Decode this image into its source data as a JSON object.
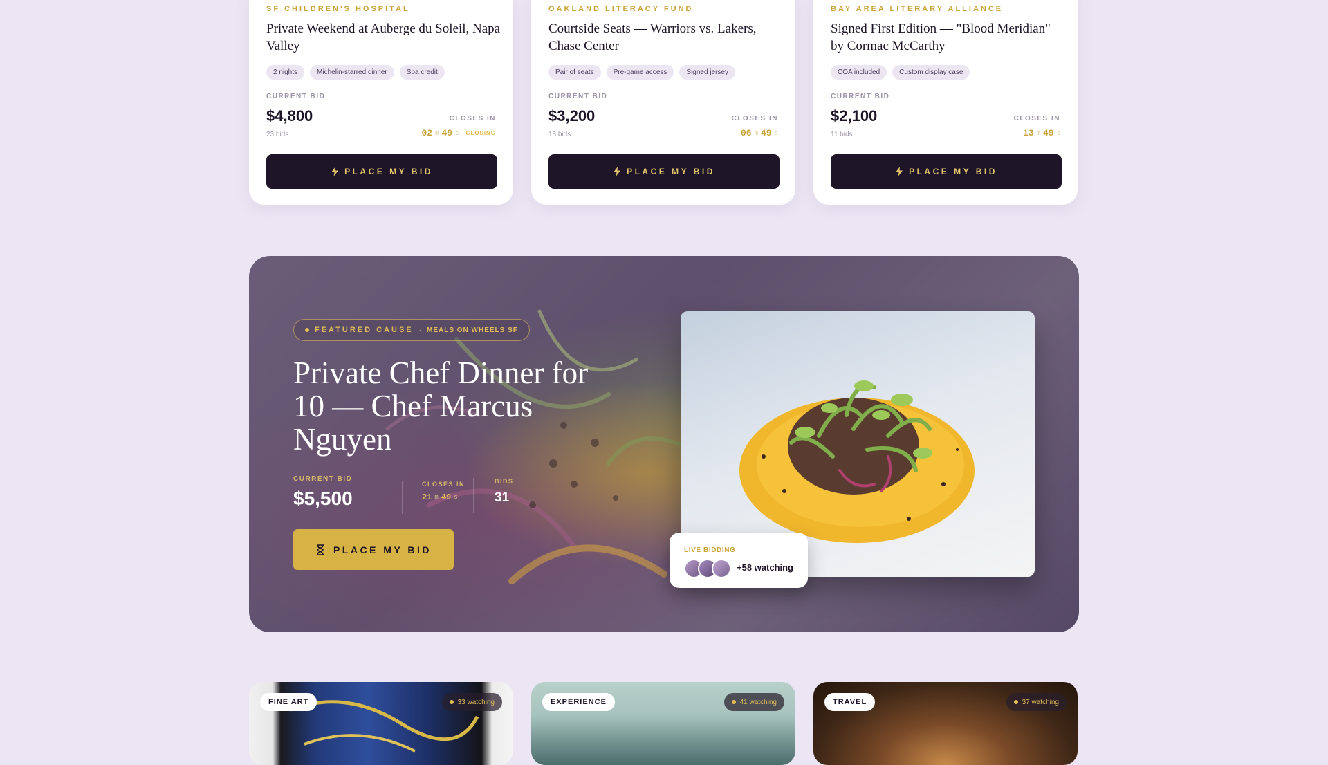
{
  "cards": [
    {
      "org": "SF CHILDREN'S HOSPITAL",
      "title": "Private Weekend at Auberge du Soleil, Napa Valley",
      "tags": [
        "2 nights",
        "Michelin-starred dinner",
        "Spa credit"
      ],
      "current_bid_label": "CURRENT BID",
      "price": "$4,800",
      "bids": "23 bids",
      "closes_label": "CLOSES IN",
      "timer": {
        "m": "02",
        "m_unit": "m",
        "s": "49",
        "s_unit": "s",
        "status": "CLOSING"
      },
      "button": "PLACE MY BID"
    },
    {
      "org": "OAKLAND LITERACY FUND",
      "title": "Courtside Seats — Warriors vs. Lakers, Chase Center",
      "tags": [
        "Pair of seats",
        "Pre-game access",
        "Signed jersey"
      ],
      "current_bid_label": "CURRENT BID",
      "price": "$3,200",
      "bids": "18 bids",
      "closes_label": "CLOSES IN",
      "timer": {
        "m": "06",
        "m_unit": "m",
        "s": "49",
        "s_unit": "s"
      },
      "button": "PLACE MY BID"
    },
    {
      "org": "BAY AREA LITERARY ALLIANCE",
      "title": "Signed First Edition — \"Blood Meridian\" by Cormac McCarthy",
      "tags": [
        "COA included",
        "Custom display case"
      ],
      "current_bid_label": "CURRENT BID",
      "price": "$2,100",
      "bids": "11 bids",
      "closes_label": "CLOSES IN",
      "timer": {
        "m": "13",
        "m_unit": "m",
        "s": "49",
        "s_unit": "s"
      },
      "button": "PLACE MY BID"
    }
  ],
  "featured": {
    "pill_label": "FEATURED CAUSE",
    "pill_sep": "·",
    "pill_link": "MEALS ON WHEELS SF",
    "title": "Private Chef Dinner for 10 — Chef Marcus Nguyen",
    "current_bid_label": "CURRENT BID",
    "current_bid": "$5,500",
    "closes_label": "CLOSES IN",
    "timer": {
      "m": "21",
      "m_unit": "m",
      "s": "49",
      "s_unit": "s"
    },
    "bids_label": "BIDS",
    "bids": "31",
    "button": "PLACE MY BID",
    "live_label": "LIVE BIDDING",
    "watching": "+58 watching"
  },
  "bottom_cards": [
    {
      "category": "FINE ART",
      "watching": "33 watching"
    },
    {
      "category": "EXPERIENCE",
      "watching": "41 watching"
    },
    {
      "category": "TRAVEL",
      "watching": "37 watching"
    }
  ],
  "colors": {
    "background": "#ece6f4",
    "accent_gold": "#d6b344",
    "dark_button": "#1e1628"
  },
  "icons": {
    "card_button": "lightning-icon",
    "featured_button": "hourglass-icon"
  }
}
